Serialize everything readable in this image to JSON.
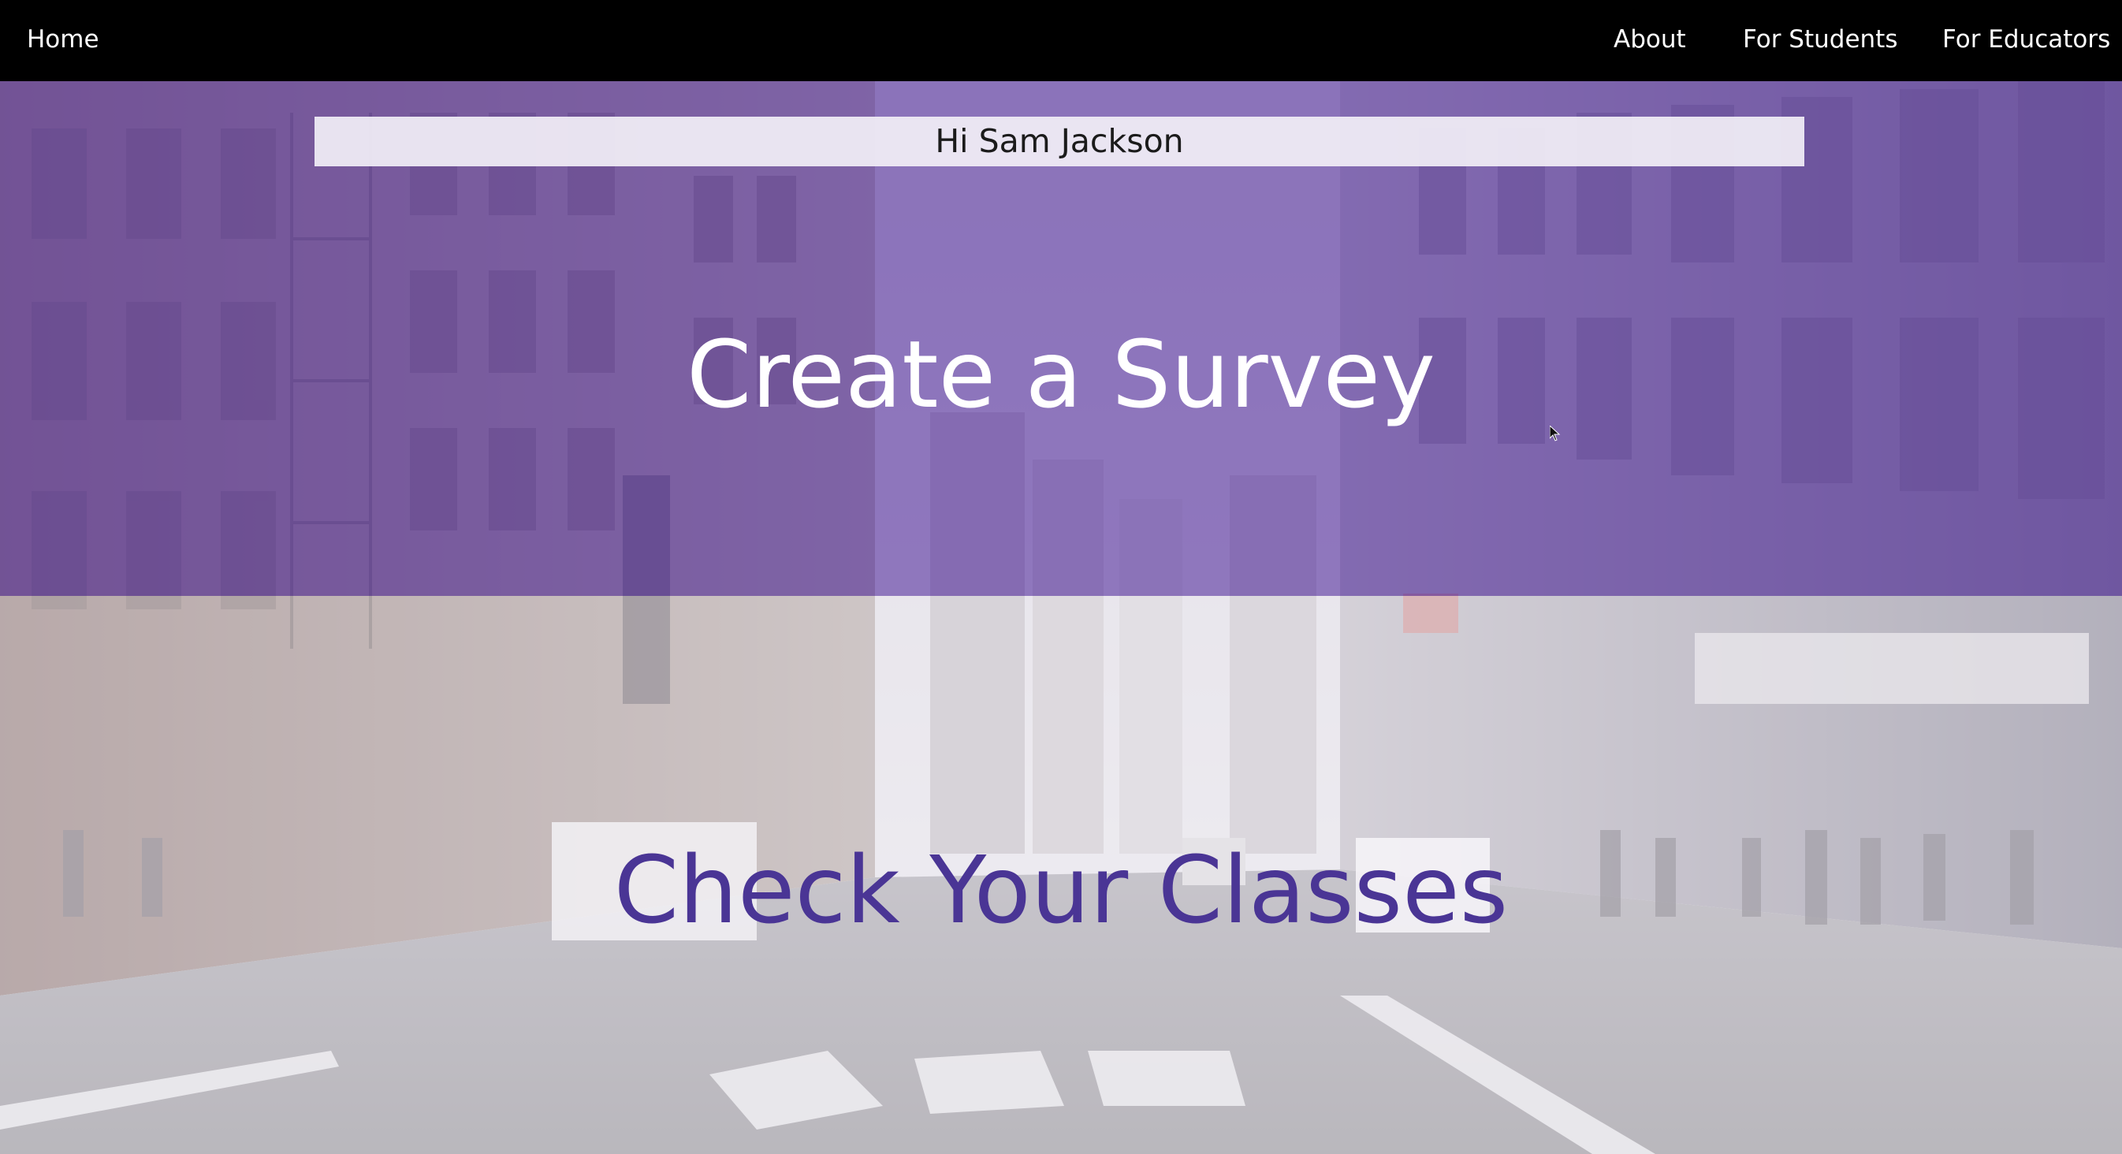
{
  "nav": {
    "home_label": "Home",
    "about_label": "About",
    "students_label": "For Students",
    "educators_label": "For Educators"
  },
  "greeting": {
    "text": "Hi Sam Jackson"
  },
  "actions": {
    "create_survey_label": "Create a Survey",
    "check_classes_label": "Check Your Classes"
  },
  "theme": {
    "nav_bg": "#000000",
    "purple_overlay": "#7656b2",
    "classes_text": "#4a3595"
  }
}
